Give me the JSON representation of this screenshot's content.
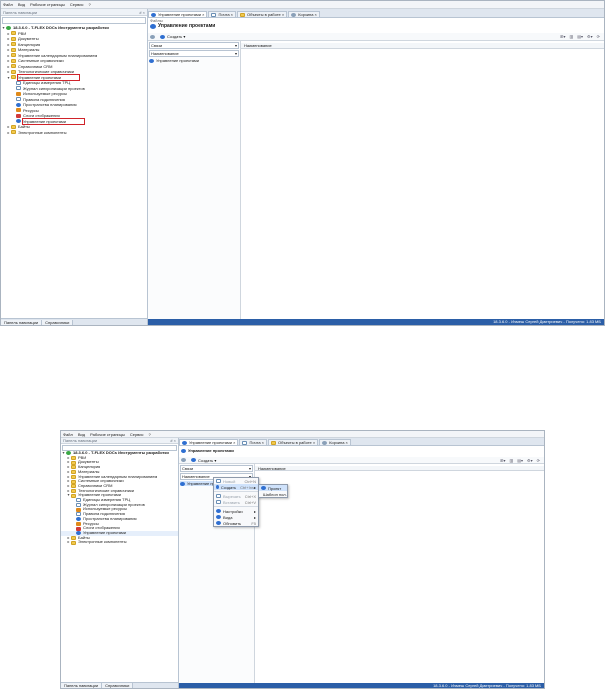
{
  "menu": [
    "Файл",
    "Вид",
    "Рабочие страницы",
    "Сервис",
    "?"
  ],
  "tabs": [
    {
      "label": "Управление проектами",
      "icon": "projects-icon"
    },
    {
      "label": "Почта",
      "icon": "mail-icon"
    },
    {
      "label": "Объекты в работе",
      "icon": "folder-icon"
    },
    {
      "label": "Корзина",
      "icon": "trash-icon"
    }
  ],
  "nav_panel": {
    "header": "Панель навигации",
    "header_extra": "# ×",
    "root": "18.3.6.0 - T-FLEX DOCs Инструменты разработки",
    "items": [
      {
        "label": "РВИ",
        "level": 1,
        "icon": "folder-icon"
      },
      {
        "label": "Документы",
        "level": 1,
        "icon": "folder-icon"
      },
      {
        "label": "Канцелярия",
        "level": 1,
        "icon": "folder-icon"
      },
      {
        "label": "Материалы",
        "level": 1,
        "icon": "folder-icon"
      },
      {
        "label": "Управление календарным планированием",
        "level": 1,
        "icon": "folder-icon"
      },
      {
        "label": "Системные справочники",
        "level": 1,
        "icon": "folder-icon"
      },
      {
        "label": "Справочники CRM",
        "level": 1,
        "icon": "folder-icon"
      },
      {
        "label": "Технологические справочники",
        "level": 1,
        "icon": "folder-icon"
      },
      {
        "label": "Управление проектами",
        "level": 1,
        "icon": "folder-icon",
        "highlight": true,
        "expanded": true
      },
      {
        "label": "Единицы измерения ТРЦ",
        "level": 2,
        "icon": "units-icon"
      },
      {
        "label": "Журнал синхронизации проектов",
        "level": 2,
        "icon": "journal-icon"
      },
      {
        "label": "Используемые ресурсы",
        "level": 2,
        "icon": "resources-icon"
      },
      {
        "label": "Правила подключения",
        "level": 2,
        "icon": "rules-icon"
      },
      {
        "label": "Пространства планирования",
        "level": 2,
        "icon": "planning-icon"
      },
      {
        "label": "Ресурсы",
        "level": 2,
        "icon": "person-icon"
      },
      {
        "label": "Слоги отображения",
        "level": 2,
        "icon": "display-icon"
      },
      {
        "label": "Управление проектами",
        "level": 2,
        "icon": "projects-icon",
        "highlight": true
      },
      {
        "label": "Байты",
        "level": 1,
        "icon": "folder-icon"
      },
      {
        "label": "Электронные компоненты",
        "level": 1,
        "icon": "folder-icon"
      }
    ],
    "bottom_tabs": [
      "Панель навигации",
      "Справочники"
    ]
  },
  "main": {
    "title": "Управление проектами",
    "breadcrumb": "Файлы",
    "create_button": "Создать",
    "filter_rows": [
      "Связи",
      "Наименование"
    ],
    "tree_item": "Управление проектами",
    "column_header": "Наименование",
    "status": "18.3.6.0 - Ичмеш Сергей Дмитриевич - Получено: 1.83 МБ"
  },
  "context_menu": {
    "items": [
      {
        "label": "Новый",
        "shortcut": "Ctrl+N",
        "disabled": true
      },
      {
        "label": "Создать",
        "shortcut": "Ctrl+Ins",
        "submenu": true,
        "selected": true
      },
      {
        "label": "Вырезать",
        "shortcut": "Ctrl+X",
        "disabled": true
      },
      {
        "label": "Вставить",
        "shortcut": "Ctrl+V",
        "disabled": true
      },
      {
        "label": "Настройки",
        "shortcut": "",
        "submenu": true
      },
      {
        "label": "Вида",
        "shortcut": "",
        "submenu": true
      },
      {
        "label": "Обновить",
        "shortcut": "F5"
      }
    ],
    "submenu": [
      "Проект",
      "Шаблон пол."
    ]
  }
}
